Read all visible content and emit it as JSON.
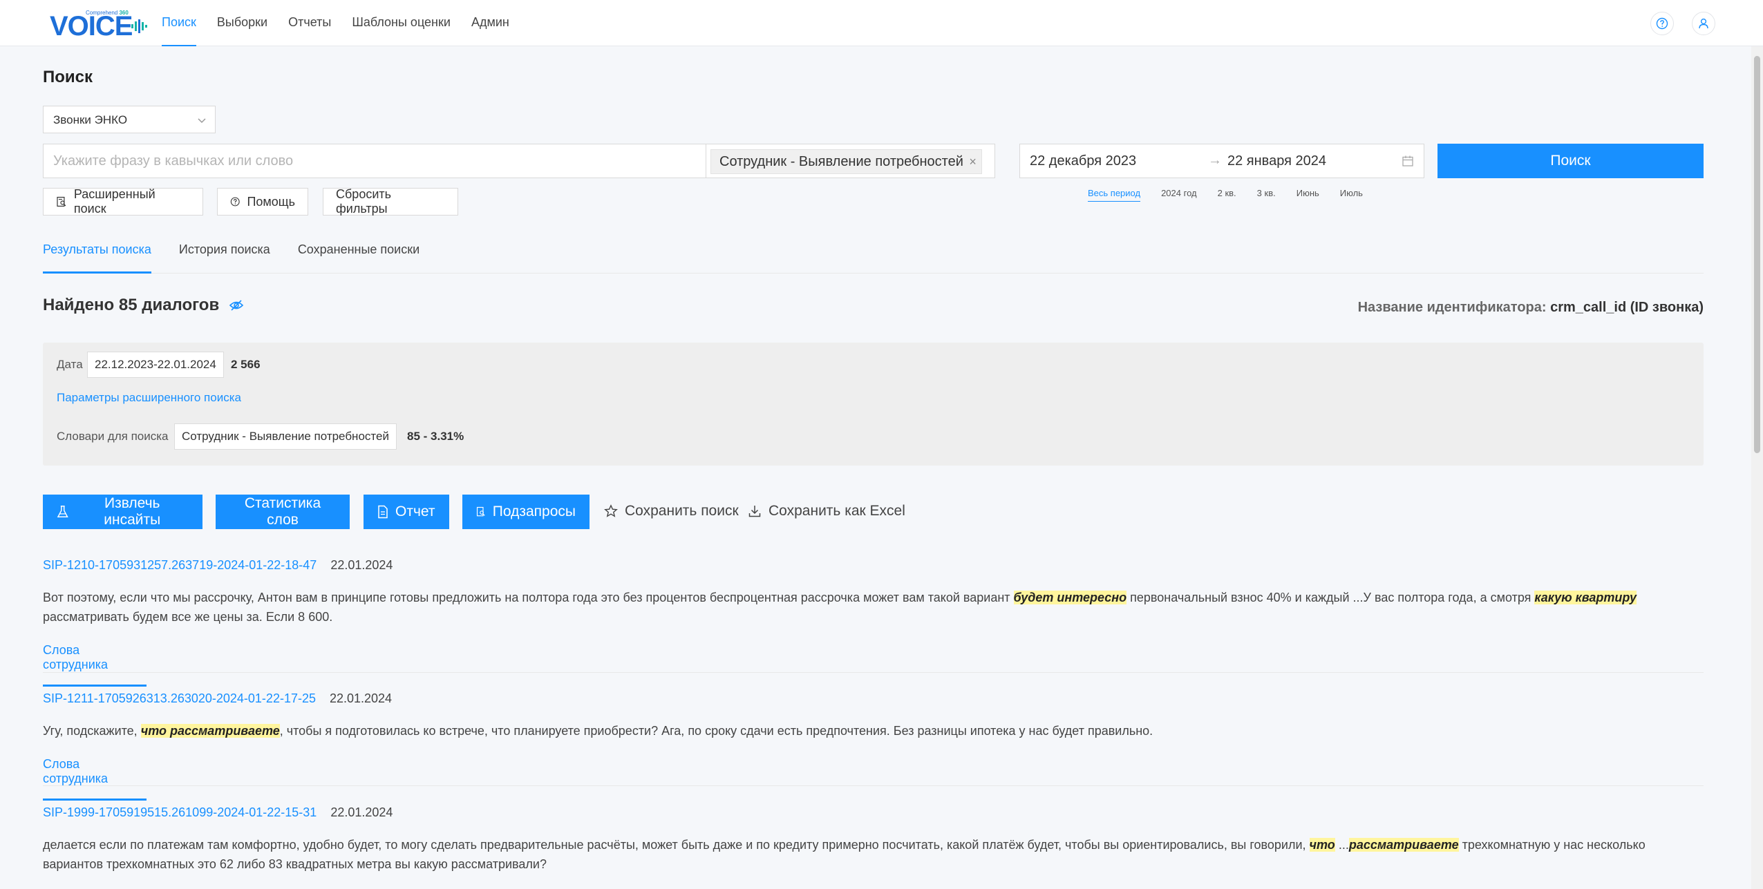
{
  "brand": {
    "name": "VOICE",
    "tag": "Comprehend",
    "tag_num": "360",
    "colors": {
      "primary": "#1890ff",
      "highlight": "#fff59d"
    }
  },
  "nav": [
    {
      "label": "Поиск",
      "active": true
    },
    {
      "label": "Выборки"
    },
    {
      "label": "Отчеты"
    },
    {
      "label": "Шаблоны оценки"
    },
    {
      "label": "Админ"
    }
  ],
  "page": {
    "title": "Поиск"
  },
  "source_select": {
    "value": "Звонки ЭНКО"
  },
  "search": {
    "placeholder": "Укажите фразу в кавычках или слово",
    "dictionary_tag": "Сотрудник - Выявление потребностей",
    "date_from": "22 декабря 2023",
    "date_to": "22 января 2024",
    "button": "Поиск"
  },
  "filter_buttons": {
    "advanced": "Расширенный поиск",
    "help": "Помощь",
    "reset": "Сбросить фильтры"
  },
  "periods": [
    {
      "label": "Весь период",
      "active": true
    },
    {
      "label": "2024 год"
    },
    {
      "label": "2 кв."
    },
    {
      "label": "3 кв."
    },
    {
      "label": "Июнь"
    },
    {
      "label": "Июль"
    }
  ],
  "tabs": [
    {
      "label": "Результаты поиска",
      "active": true
    },
    {
      "label": "История поиска"
    },
    {
      "label": "Сохраненные поиски"
    }
  ],
  "summary": {
    "found": "Найдено 85 диалогов",
    "identifier_label": "Название идентификатора:",
    "identifier_value": "crm_call_id (ID звонка)"
  },
  "filter_panel": {
    "date_label": "Дата",
    "date_value": "22.12.2023-22.01.2024",
    "date_count": "2 566",
    "advanced_link": "Параметры расширенного поиска",
    "dict_label": "Словари для поиска",
    "dict_value": "Сотрудник - Выявление потребностей",
    "dict_count": "85 - 3.31%"
  },
  "actions": {
    "insights": "Извлечь инсайты",
    "word_stats": "Статистика слов",
    "report": "Отчет",
    "subqueries": "Подзапросы",
    "save_search": "Сохранить поиск",
    "save_excel": "Сохранить как Excel"
  },
  "results": [
    {
      "id": "SIP-1210-1705931257.263719-2024-01-22-18-47",
      "date": "22.01.2024",
      "t1": "Вот поэтому, если что мы рассрочку, Антон вам в принципе готовы предложить на полтора года это без процентов беспроцентная рассрочка может вам такой вариант ",
      "h1": "будет интересно",
      "t2": " первоначальный взнос 40% и каждый ...У вас полтора года, а смотря ",
      "h2": "какую квартиру",
      "t3": " рассматривать будем все же цены за. Если 8 600.",
      "words": "Слова сотрудника"
    },
    {
      "id": "SIP-1211-1705926313.263020-2024-01-22-17-25",
      "date": "22.01.2024",
      "t1": "Угу, подскажите, ",
      "h1": "что рассматриваете",
      "t2": ", чтобы я подготовилась ко встрече, что планируете приобрести? Ага, по сроку сдачи есть предпочтения. Без разницы ипотека у нас будет правильно.",
      "words": "Слова сотрудника"
    },
    {
      "id": "SIP-1999-1705919515.261099-2024-01-22-15-31",
      "date": "22.01.2024",
      "t1": "делается если по платежам там комфортно, удобно будет, то могу сделать предварительные расчёты, может быть даже и по кредиту примерно посчитать, какой платёж будет, чтобы вы ориентировались, вы говорили, ",
      "h1": "что",
      "t2": " ...",
      "h2": "рассматриваете",
      "t3": " трехкомнатную у нас несколько вариантов трехкомнатных это 62 либо 83 квадратных метра вы какую рассматривали?"
    }
  ]
}
